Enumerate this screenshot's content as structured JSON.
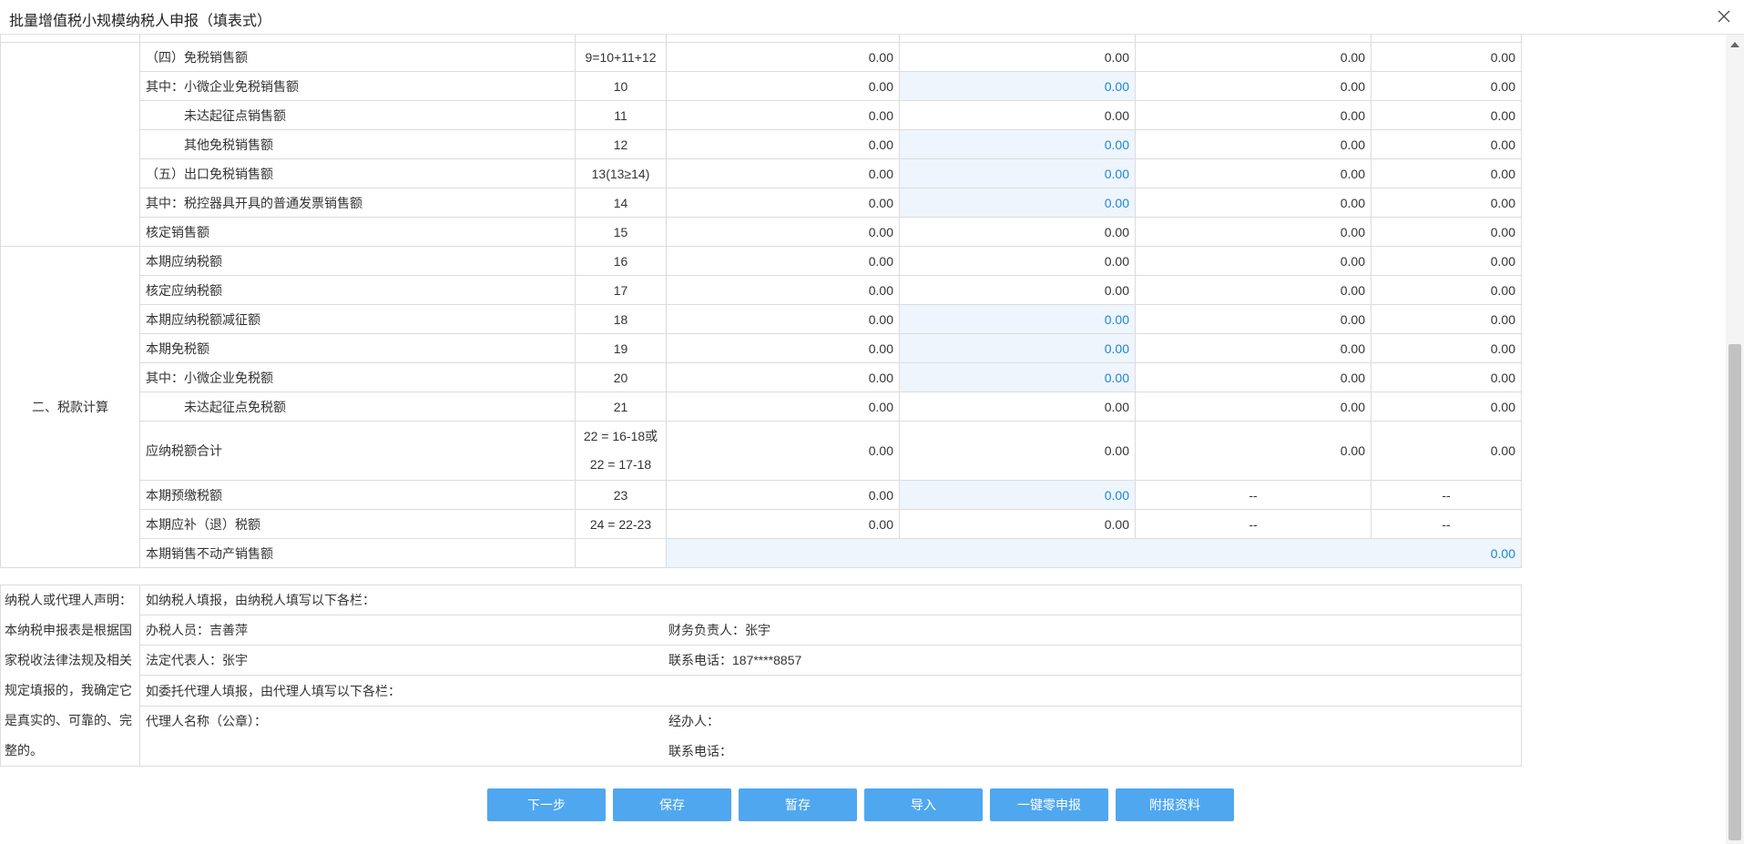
{
  "window": {
    "title": "批量增值税小规模纳税人申报（填表式）"
  },
  "rows": [
    {
      "item": "（四）免税销售额",
      "no": "9=10+11+12",
      "c1": "0.00",
      "c2": "0.00",
      "c3": "0.00",
      "c4": "0.00"
    },
    {
      "item": "其中：小微企业免税销售额",
      "no": "10",
      "c1": "0.00",
      "c2": "0.00",
      "c3": "0.00",
      "c4": "0.00"
    },
    {
      "item": "未达起征点销售额",
      "no": "11",
      "c1": "0.00",
      "c2": "0.00",
      "c3": "0.00",
      "c4": "0.00"
    },
    {
      "item": "其他免税销售额",
      "no": "12",
      "c1": "0.00",
      "c2": "0.00",
      "c3": "0.00",
      "c4": "0.00"
    },
    {
      "item": "（五）出口免税销售额",
      "no": "13(13≥14)",
      "c1": "0.00",
      "c2": "0.00",
      "c3": "0.00",
      "c4": "0.00"
    },
    {
      "item": "其中：税控器具开具的普通发票销售额",
      "no": "14",
      "c1": "0.00",
      "c2": "0.00",
      "c3": "0.00",
      "c4": "0.00"
    },
    {
      "item": "核定销售额",
      "no": "15",
      "c1": "0.00",
      "c2": "0.00",
      "c3": "0.00",
      "c4": "0.00"
    },
    {
      "item": "本期应纳税额",
      "no": "16",
      "c1": "0.00",
      "c2": "0.00",
      "c3": "0.00",
      "c4": "0.00"
    },
    {
      "item": "核定应纳税额",
      "no": "17",
      "c1": "0.00",
      "c2": "0.00",
      "c3": "0.00",
      "c4": "0.00"
    },
    {
      "item": "本期应纳税额减征额",
      "no": "18",
      "c1": "0.00",
      "c2": "0.00",
      "c3": "0.00",
      "c4": "0.00"
    },
    {
      "item": "本期免税额",
      "no": "19",
      "c1": "0.00",
      "c2": "0.00",
      "c3": "0.00",
      "c4": "0.00"
    },
    {
      "item": "其中：小微企业免税额",
      "no": "20",
      "c1": "0.00",
      "c2": "0.00",
      "c3": "0.00",
      "c4": "0.00"
    },
    {
      "item": "未达起征点免税额",
      "no": "21",
      "c1": "0.00",
      "c2": "0.00",
      "c3": "0.00",
      "c4": "0.00"
    },
    {
      "item": "应纳税额合计",
      "no_line1": "22 = 16-18或",
      "no_line2": "22 = 17-18",
      "c1": "0.00",
      "c2": "0.00",
      "c3": "0.00",
      "c4": "0.00"
    },
    {
      "item": "本期预缴税额",
      "no": "23",
      "c1": "0.00",
      "c2": "0.00",
      "c3": "--",
      "c4": "--"
    },
    {
      "item": "本期应补（退）税额",
      "no": "24 = 22-23",
      "c1": "0.00",
      "c2": "0.00",
      "c3": "--",
      "c4": "--"
    },
    {
      "item": "本期销售不动产销售额",
      "no": "",
      "total": "0.00"
    }
  ],
  "sections": {
    "tax_calc": "二、税款计算"
  },
  "declaration": {
    "statement": "纳税人或代理人声明：本纳税申报表是根据国家税收法律法规及相关规定填报的，我确定它是真实的、可靠的、完整的。",
    "self_filing": "如纳税人填报，由纳税人填写以下各栏：",
    "handler": "办税人员：吉善萍",
    "finance_head": "财务负责人：张宇",
    "legal_rep": "法定代表人：张宇",
    "phone": "联系电话：187****8857",
    "agent_filing": "如委托代理人填报，由代理人填写以下各栏：",
    "agent_name": "代理人名称（公章）：",
    "agent_handler": "经办人：",
    "agent_phone": "联系电话："
  },
  "buttons": {
    "next": "下一步",
    "save": "保存",
    "temp_save": "暂存",
    "import": "导入",
    "zero_declare": "一键零申报",
    "attachments": "附报资料"
  },
  "icons": {
    "close": "close-icon",
    "scroll_up": "scroll-up-arrow-icon"
  },
  "colors": {
    "button": "#4fa7ef",
    "editable_bg": "#eef5fd",
    "editable_text": "#1b86d6"
  }
}
